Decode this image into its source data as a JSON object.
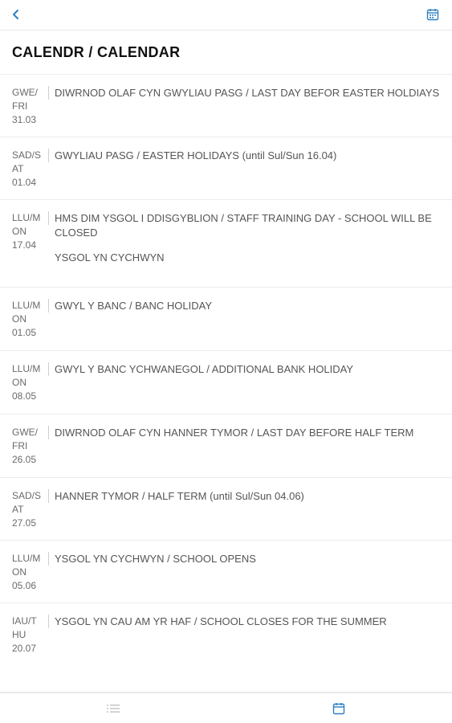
{
  "header": {
    "back_icon": "chevron-left-icon",
    "calendar_icon": "calendar-icon",
    "accent_color": "#2d7fc1"
  },
  "page": {
    "title": "CALENDR / CALENDAR"
  },
  "events": [
    {
      "day_lines": [
        "GWE/",
        "FRI"
      ],
      "date": "31.03",
      "items": [
        "DIWRNOD OLAF CYN GWYLIAU PASG / LAST DAY BEFOR EASTER HOLDIAYS"
      ]
    },
    {
      "day_lines": [
        "SAD/S",
        "AT"
      ],
      "date": "01.04",
      "items": [
        "GWYLIAU PASG / EASTER HOLIDAYS (until Sul/Sun 16.04)"
      ]
    },
    {
      "day_lines": [
        "LLU/M",
        "ON"
      ],
      "date": "17.04",
      "items": [
        "HMS DIM YSGOL I DDISGYBLION / STAFF TRAINING DAY - SCHOOL WILL BE CLOSED",
        "YSGOL YN CYCHWYN"
      ]
    },
    {
      "day_lines": [
        "LLU/M",
        "ON"
      ],
      "date": "01.05",
      "items": [
        "GWYL Y BANC / BANC HOLIDAY"
      ]
    },
    {
      "day_lines": [
        "LLU/M",
        "ON"
      ],
      "date": "08.05",
      "items": [
        "GWYL Y BANC YCHWANEGOL / ADDITIONAL BANK HOLIDAY"
      ]
    },
    {
      "day_lines": [
        "GWE/",
        "FRI"
      ],
      "date": "26.05",
      "items": [
        "DIWRNOD OLAF CYN HANNER TYMOR / LAST DAY BEFORE HALF TERM"
      ]
    },
    {
      "day_lines": [
        "SAD/S",
        "AT"
      ],
      "date": "27.05",
      "items": [
        "HANNER TYMOR / HALF TERM (until Sul/Sun 04.06)"
      ]
    },
    {
      "day_lines": [
        "LLU/M",
        "ON"
      ],
      "date": "05.06",
      "items": [
        "YSGOL YN CYCHWYN / SCHOOL OPENS"
      ]
    },
    {
      "day_lines": [
        "IAU/T",
        "HU"
      ],
      "date": "20.07",
      "items": [
        "YSGOL YN CAU AM YR HAF / SCHOOL CLOSES FOR THE SUMMER"
      ]
    }
  ],
  "bottom_nav": {
    "list_icon": "list-icon",
    "calendar_icon": "calendar-icon",
    "list_color": "#c8c8c8",
    "calendar_color": "#2d7fc1"
  }
}
